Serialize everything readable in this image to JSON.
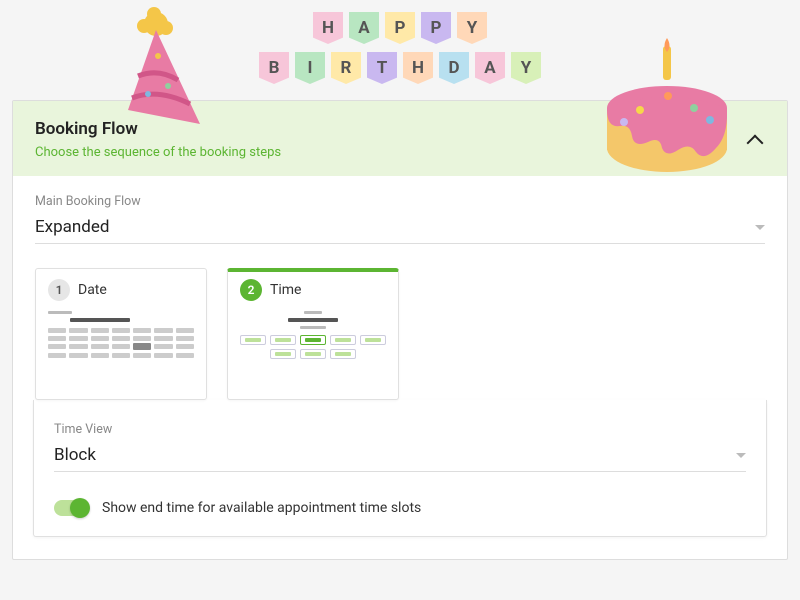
{
  "panel": {
    "title": "Booking Flow",
    "subtitle": "Choose the sequence of the booking steps"
  },
  "mainFlow": {
    "label": "Main Booking Flow",
    "value": "Expanded"
  },
  "steps": [
    {
      "num": "1",
      "title": "Date"
    },
    {
      "num": "2",
      "title": "Time"
    }
  ],
  "timeView": {
    "label": "Time View",
    "value": "Block"
  },
  "toggle": {
    "label": "Show end time for available appointment time slots",
    "on": true
  },
  "banner": {
    "line1": [
      "H",
      "A",
      "P",
      "P",
      "Y"
    ],
    "line2": [
      "B",
      "I",
      "R",
      "T",
      "H",
      "D",
      "A",
      "Y"
    ],
    "colors": [
      "#f7c6d9",
      "#b8e6c1",
      "#ffe9a8",
      "#c9b8f0",
      "#ffd8b8",
      "#b8e0f0",
      "#f7c6d9",
      "#d8f0b8"
    ]
  }
}
